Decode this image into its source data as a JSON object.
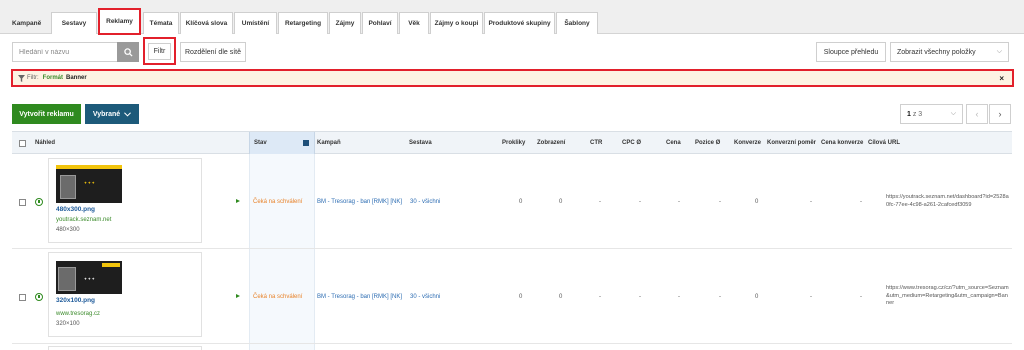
{
  "tabs": [
    {
      "label": "Kampaně"
    },
    {
      "label": "Sestavy"
    },
    {
      "label": "Reklamy"
    },
    {
      "label": "Témata"
    },
    {
      "label": "Klíčová slova"
    },
    {
      "label": "Umístění"
    },
    {
      "label": "Retargeting"
    },
    {
      "label": "Zájmy"
    },
    {
      "label": "Pohlaví"
    },
    {
      "label": "Věk"
    },
    {
      "label": "Zájmy o koupi"
    },
    {
      "label": "Produktové skupiny"
    },
    {
      "label": "Šablony"
    }
  ],
  "toolbar": {
    "search_placeholder": "Hledání v názvu",
    "filter_label": "Filtr",
    "split_label": "Rozdělení dle sítě",
    "columns_label": "Sloupce přehledu",
    "view_label": "Zobrazit všechny položky"
  },
  "filter_bar": {
    "prefix": "Filtr:",
    "name": "Formát",
    "value": "Banner",
    "close": "×"
  },
  "actions": {
    "create_label": "Vytvořit reklamu",
    "selected_label": "Vybrané"
  },
  "pager": {
    "current": "1",
    "of": "z 3",
    "prev": "‹",
    "next": "›"
  },
  "columns": {
    "preview": "Náhled",
    "status": "Stav",
    "campaign": "Kampaň",
    "group": "Sestava",
    "clicks": "Prokliky",
    "impressions": "Zobrazení",
    "ctr": "CTR",
    "cpc": "CPC Ø",
    "price": "Cena",
    "position": "Pozice Ø",
    "conversions": "Konverze",
    "conv_ratio": "Konverzní poměr",
    "conv_price": "Cena konverze",
    "target_url": "Cílová URL"
  },
  "rows": [
    {
      "name": "480x300.png",
      "url": "youtrack.seznam.net",
      "size": "480×300",
      "status": "Čeká na schválení",
      "campaign": "BM - Tresorag - ban [RMK] [NK]",
      "group": "30 - všichni",
      "clicks": "0",
      "impressions": "0",
      "ctr": "-",
      "cpc": "-",
      "price": "-",
      "position": "-",
      "conversions": "0",
      "conv_ratio": "-",
      "conv_price": "-",
      "target_url": "https://youtrack.seznam.net/dashboard?id=2528a0fc-77ee-4c98-a261-2cafcedf3059"
    },
    {
      "name": "320x100.png",
      "url": "www.tresorag.cz",
      "size": "320×100",
      "status": "Čeká na schválení",
      "campaign": "BM - Tresorag - ban [RMK] [NK]",
      "group": "30 - všichni",
      "clicks": "0",
      "impressions": "0",
      "ctr": "-",
      "cpc": "-",
      "price": "-",
      "position": "-",
      "conversions": "0",
      "conv_ratio": "-",
      "conv_price": "-",
      "target_url": "https://www.tresorag.cz/cz/?utm_source=Seznam&utm_medium=Retargeting&utm_campaign=Banner"
    }
  ],
  "colors": {
    "accent_green": "#2f8a1f",
    "accent_blue": "#1d5a7a",
    "highlight_red": "#e2202b",
    "status_orange": "#e8832a"
  }
}
